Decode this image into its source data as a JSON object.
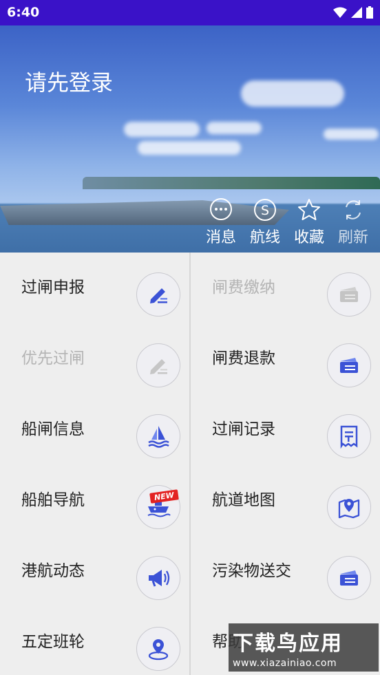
{
  "status_bar": {
    "time": "6:40"
  },
  "header": {
    "login_prompt": "请先登录"
  },
  "actions": [
    {
      "label": "消息",
      "icon": "message-icon"
    },
    {
      "label": "航线",
      "icon": "route-icon"
    },
    {
      "label": "收藏",
      "icon": "star-icon"
    },
    {
      "label": "刷新",
      "icon": "refresh-icon"
    }
  ],
  "menu": [
    {
      "label": "过闸申报",
      "icon": "pencil-icon",
      "enabled": true
    },
    {
      "label": "闸费缴纳",
      "icon": "card-icon",
      "enabled": false
    },
    {
      "label": "优先过闸",
      "icon": "pencil-icon",
      "enabled": false
    },
    {
      "label": "闸费退款",
      "icon": "card-icon",
      "enabled": true
    },
    {
      "label": "船闸信息",
      "icon": "sailboat-icon",
      "enabled": true
    },
    {
      "label": "过闸记录",
      "icon": "receipt-icon",
      "enabled": true
    },
    {
      "label": "船舶导航",
      "icon": "ship-icon",
      "enabled": true,
      "badge": "NEW"
    },
    {
      "label": "航道地图",
      "icon": "map-pin-icon",
      "enabled": true
    },
    {
      "label": "港航动态",
      "icon": "megaphone-icon",
      "enabled": true
    },
    {
      "label": "污染物送交",
      "icon": "card-icon",
      "enabled": true
    },
    {
      "label": "五定班轮",
      "icon": "location-icon",
      "enabled": true
    },
    {
      "label": "帮助",
      "icon": "help-icon",
      "enabled": true
    }
  ],
  "watermark": {
    "title": "下载鸟应用",
    "url": "www.xiazainiao.com"
  },
  "colors": {
    "accent": "#3a12c8",
    "icon_blue": "#3b52d6",
    "disabled": "#b4b4b4"
  }
}
